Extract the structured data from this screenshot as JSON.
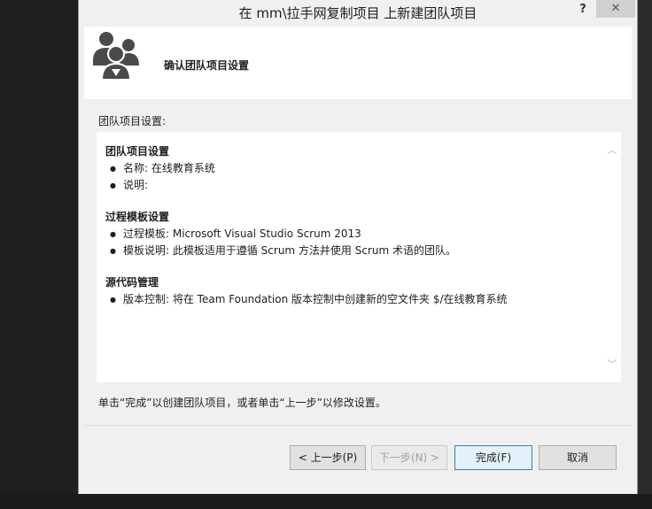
{
  "window": {
    "title": "在 mm\\拉手网复制项目 上新建团队项目",
    "help_label": "?",
    "close_label": "✕"
  },
  "header": {
    "title": "确认团队项目设置",
    "icon": "team-people-icon"
  },
  "section_label": "团队项目设置:",
  "summary": {
    "groups": [
      {
        "title": "团队项目设置",
        "items": [
          "名称: 在线教育系统",
          "说明:"
        ]
      },
      {
        "title": "过程模板设置",
        "items": [
          "过程模板: Microsoft Visual Studio Scrum 2013",
          "模板说明: 此模板适用于遵循 Scrum 方法并使用 Scrum 术语的团队。"
        ]
      },
      {
        "title": "源代码管理",
        "items": [
          "版本控制: 将在 Team Foundation 版本控制中创建新的空文件夹 $/在线教育系统"
        ]
      }
    ]
  },
  "footer_note": "单击“完成”以创建团队项目，或者单击“上一步”以修改设置。",
  "buttons": {
    "prev": "< 上一步(P)",
    "next": "下一步(N) >",
    "finish": "完成(F)",
    "cancel": "取消"
  }
}
